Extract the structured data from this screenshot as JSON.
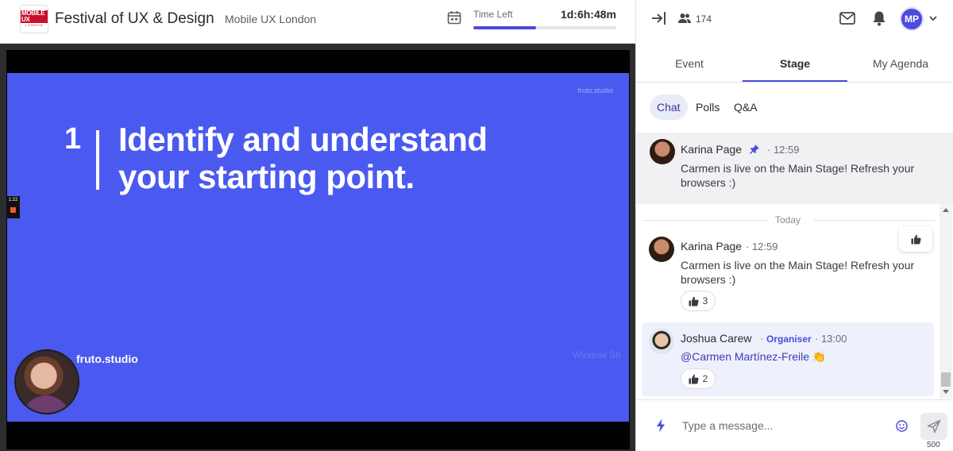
{
  "header": {
    "logo_line1": "MOBILE UX",
    "logo_line2": "LONDON",
    "event_title": "Festival of UX & Design",
    "event_subtitle": "Mobile UX London",
    "time_left_label": "Time Left",
    "time_left_value": "1d:6h:48m",
    "time_progress_percent": 44
  },
  "stage": {
    "slide_watermark": "fruto.studio",
    "slide_number": "1",
    "slide_heading": "Identify and understand your starting point.",
    "presenter_name": "fruto.studio",
    "side_badge_time": "1:22",
    "window_ghost": "Window Sh"
  },
  "panel": {
    "attendee_count": "174",
    "avatar_initials": "MP",
    "tabs": [
      "Event",
      "Stage",
      "My Agenda"
    ],
    "active_tab": "Stage",
    "subtabs": [
      "Chat",
      "Polls",
      "Q&A"
    ],
    "active_subtab": "Chat",
    "pinned_message": {
      "author": "Karina Page",
      "time": "12:59",
      "text": "Carmen is live on the Main Stage! Refresh your browsers :)"
    },
    "date_divider": "Today",
    "messages": [
      {
        "author": "Karina Page",
        "time": "12:59",
        "text": "Carmen is live on the Main Stage! Refresh your browsers :)",
        "likes": "3"
      },
      {
        "author": "Joshua Carew",
        "role": "Organiser",
        "time": "13:00",
        "mention": "@Carmen Martínez-Freile",
        "likes": "2"
      }
    ],
    "composer_placeholder": "Type a message...",
    "char_limit": "500"
  },
  "colors": {
    "accent": "#4b4be0",
    "slide_background": "#4a5af0",
    "highlight_message": "#eef1fb"
  }
}
